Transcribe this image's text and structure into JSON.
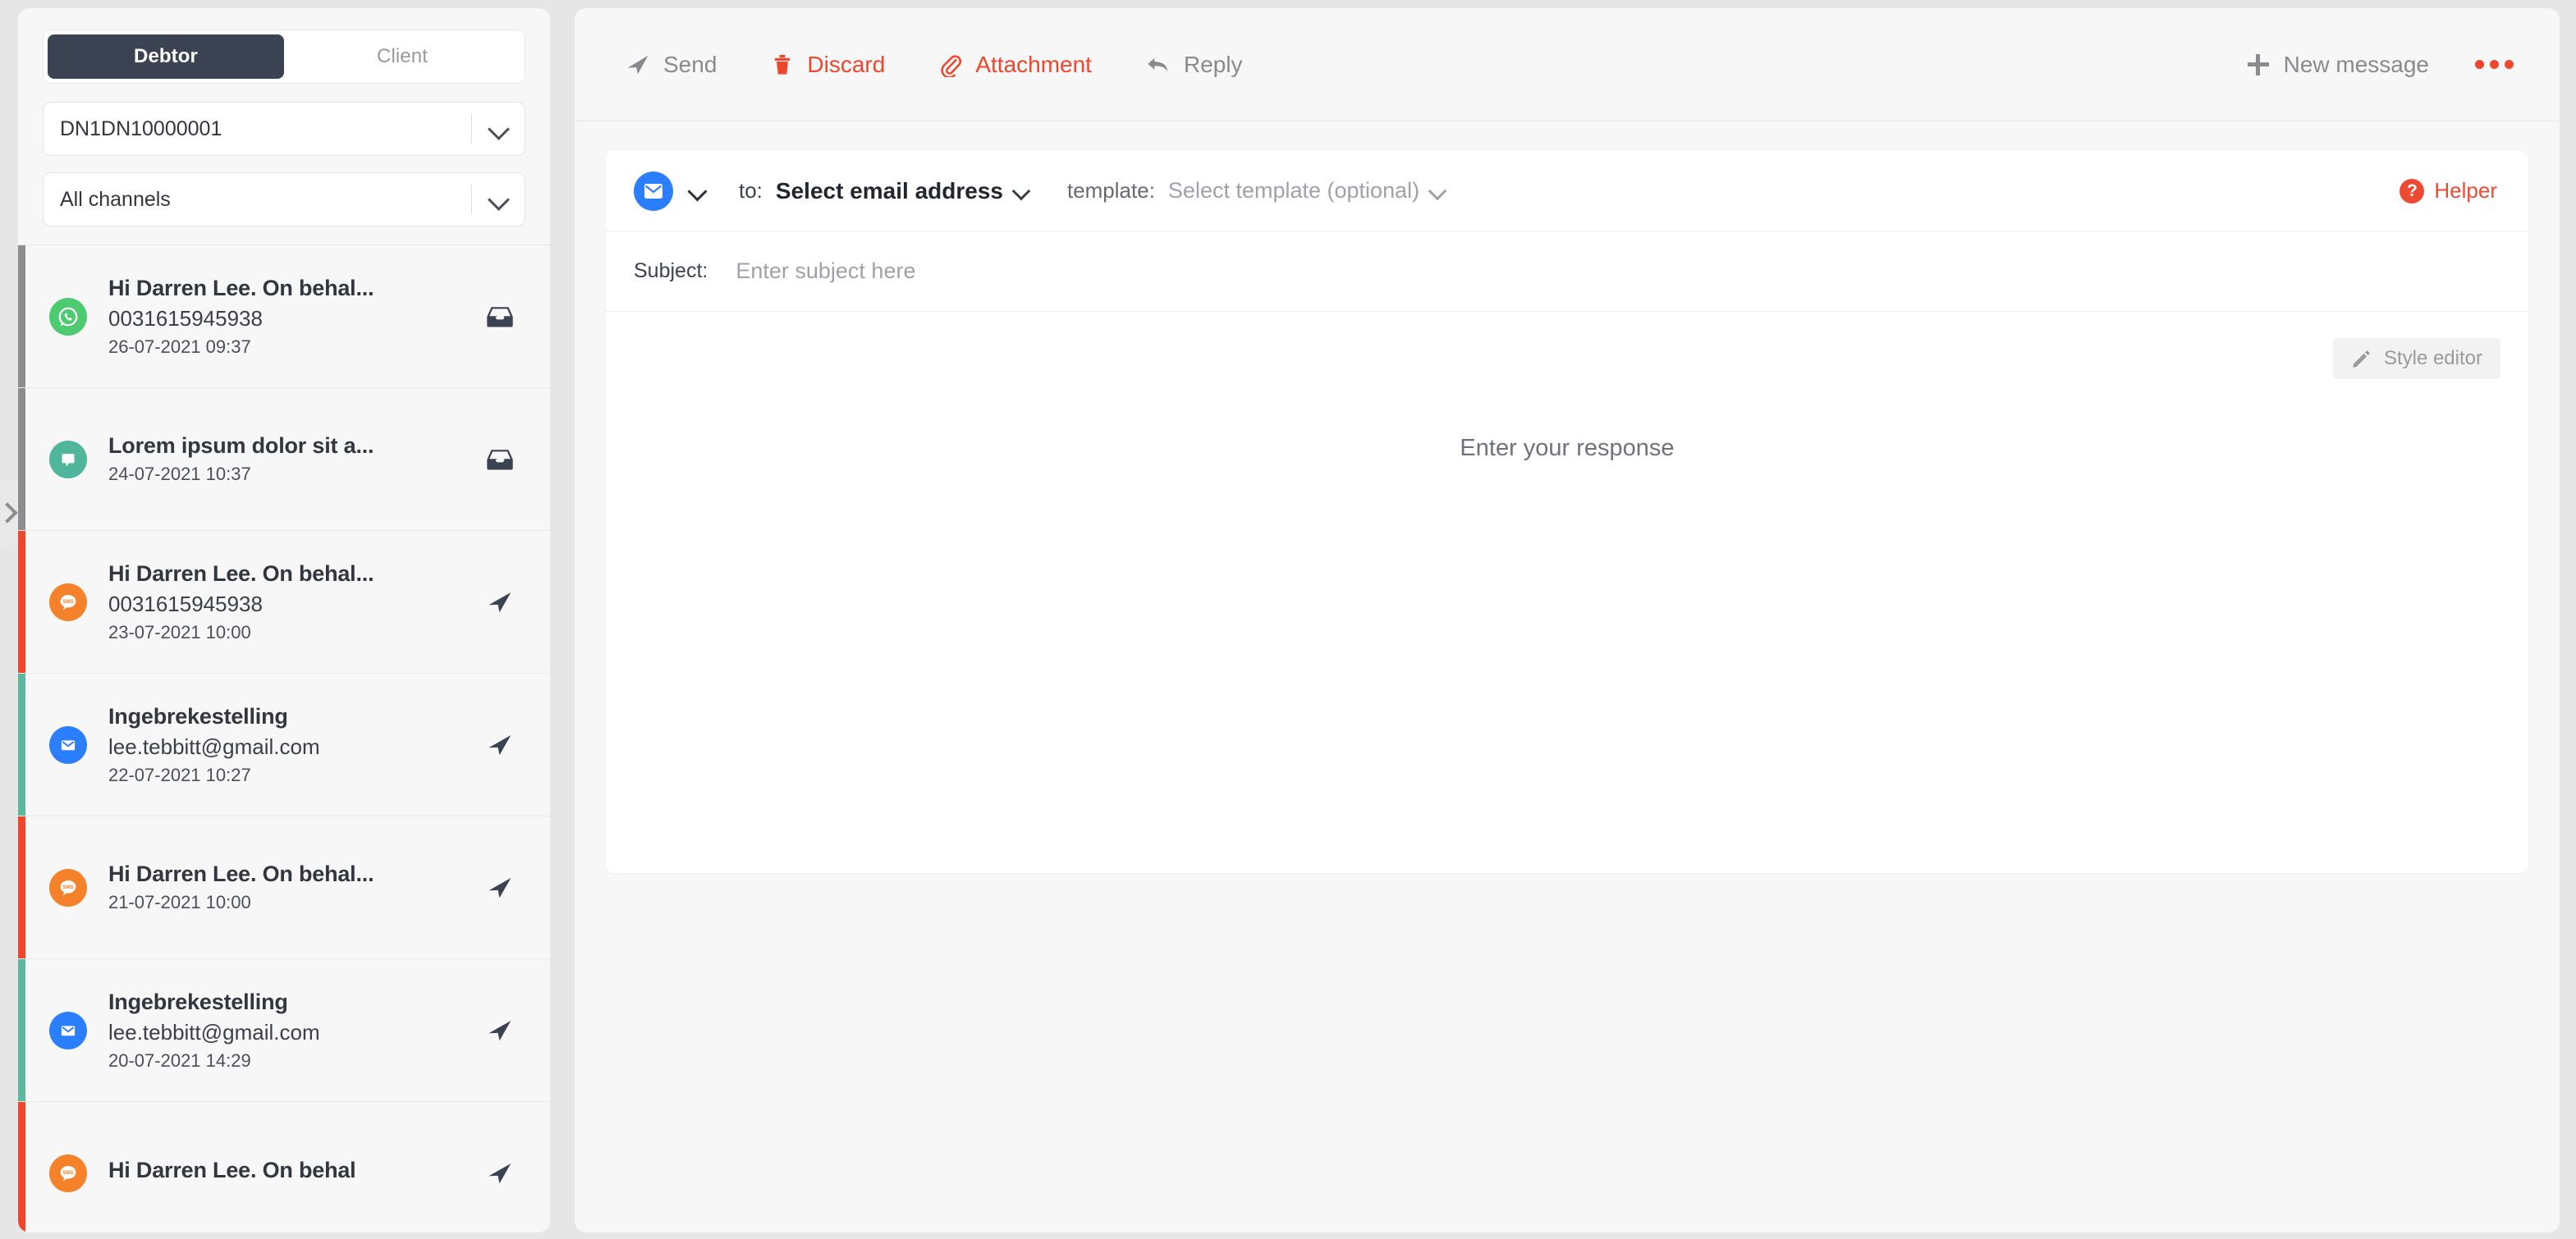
{
  "sidebar": {
    "tabs": [
      {
        "label": "Debtor",
        "active": true
      },
      {
        "label": "Client",
        "active": false
      }
    ],
    "filters": [
      {
        "name": "case-select",
        "value": "DN1DN10000001"
      },
      {
        "name": "channel-select",
        "value": "All channels"
      }
    ],
    "messages": [
      {
        "title": "Hi Darren Lee. On behal...",
        "sub": "0031615945938",
        "date": "26-07-2021 09:37",
        "channel": "whatsapp",
        "status": "inbox",
        "accent": "#8d8d92"
      },
      {
        "title": "Lorem ipsum dolor sit a...",
        "sub": "",
        "date": "24-07-2021 10:37",
        "channel": "chat",
        "status": "inbox",
        "accent": "#8d8d92"
      },
      {
        "title": "Hi Darren Lee. On behal...",
        "sub": "0031615945938",
        "date": "23-07-2021 10:00",
        "channel": "sms",
        "status": "sent",
        "accent": "#f0462c"
      },
      {
        "title": "Ingebrekestelling",
        "sub": "lee.tebbitt@gmail.com",
        "date": "22-07-2021 10:27",
        "channel": "email",
        "status": "sent",
        "accent": "#5cb79e"
      },
      {
        "title": "Hi Darren Lee. On behal...",
        "sub": "",
        "date": "21-07-2021 10:00",
        "channel": "sms",
        "status": "sent",
        "accent": "#f0462c"
      },
      {
        "title": "Ingebrekestelling",
        "sub": "lee.tebbitt@gmail.com",
        "date": "20-07-2021 14:29",
        "channel": "email",
        "status": "sent",
        "accent": "#5cb79e"
      },
      {
        "title": "Hi Darren Lee. On behal",
        "sub": "",
        "date": "",
        "channel": "sms",
        "status": "sent",
        "accent": "#f0462c"
      }
    ]
  },
  "toolbar": {
    "send_label": "Send",
    "discard_label": "Discard",
    "attachment_label": "Attachment",
    "reply_label": "Reply",
    "new_message_label": "New message",
    "more_label": "..."
  },
  "compose": {
    "to_label": "to:",
    "to_value": "Select email address",
    "template_label": "template:",
    "template_value": "Select template (optional)",
    "helper_label": "Helper",
    "helper_glyph": "?",
    "subject_label": "Subject:",
    "subject_value": "",
    "subject_placeholder": "Enter subject here",
    "style_editor_label": "Style editor",
    "body_placeholder": "Enter your response"
  },
  "colors": {
    "accent_red": "#f0462c",
    "whatsapp_green": "#4ecb71",
    "chat_teal": "#4fb59b",
    "sms_orange": "#f5822a",
    "email_blue": "#2b7fff",
    "dark_navy": "#3b4252"
  }
}
